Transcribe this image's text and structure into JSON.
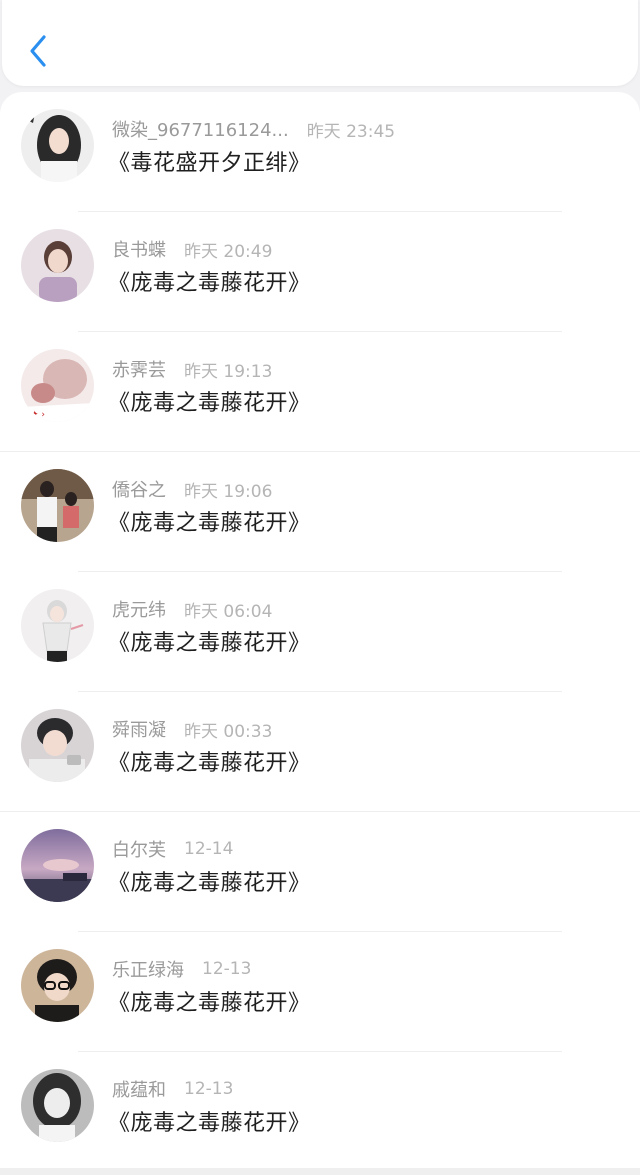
{
  "colors": {
    "accent": "#2b8ff0",
    "background": "#f2f2f4",
    "card": "#ffffff"
  },
  "header": {
    "back_icon": "chevron-left-icon"
  },
  "items": [
    {
      "name": "微染_9677116124...",
      "time": "昨天 23:45",
      "book": "《毒花盛开夕正绯》"
    },
    {
      "name": "良书蝶",
      "time": "昨天 20:49",
      "book": "《庞毒之毒藤花开》"
    },
    {
      "name": "赤霁芸",
      "time": "昨天 19:13",
      "book": "《庞毒之毒藤花开》"
    },
    {
      "name": "僑谷之",
      "time": "昨天 19:06",
      "book": "《庞毒之毒藤花开》"
    },
    {
      "name": "虎元纬",
      "time": "昨天 06:04",
      "book": "《庞毒之毒藤花开》"
    },
    {
      "name": "舜雨凝",
      "time": "昨天 00:33",
      "book": "《庞毒之毒藤花开》"
    },
    {
      "name": "白尔芙",
      "time": "12-14",
      "book": "《庞毒之毒藤花开》"
    },
    {
      "name": "乐正绿海",
      "time": "12-13",
      "book": "《庞毒之毒藤花开》"
    },
    {
      "name": "戚蕴和",
      "time": "12-13",
      "book": "《庞毒之毒藤花开》"
    }
  ]
}
